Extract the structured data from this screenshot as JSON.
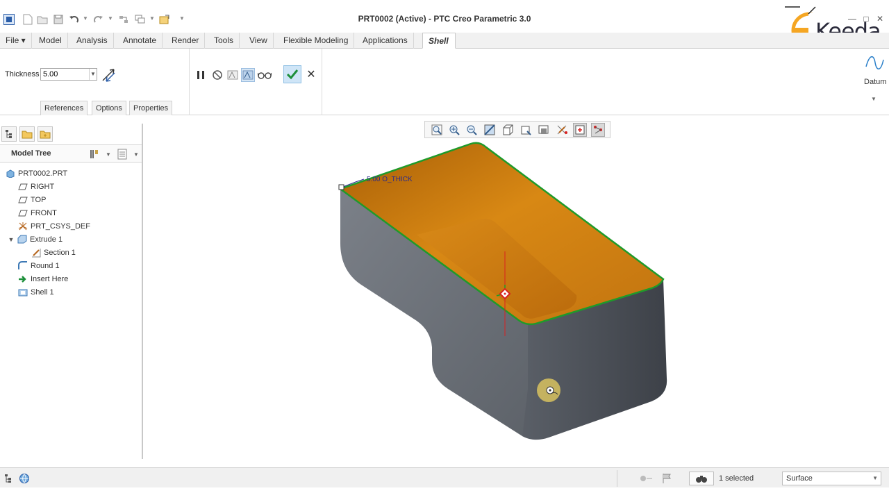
{
  "window": {
    "title": "PRT0002 (Active) - PTC Creo Parametric 3.0",
    "controls": [
      "?",
      "—",
      "□",
      "✕"
    ]
  },
  "quick_access": {
    "icons": [
      "new-file-icon",
      "open-file-icon",
      "save-icon",
      "undo-icon",
      "redo-icon",
      "regenerate-icon",
      "windows-icon",
      "close-window-icon",
      "customize-icon"
    ]
  },
  "ribbon": {
    "tabs": [
      {
        "label": "File ▾"
      },
      {
        "label": "Model"
      },
      {
        "label": "Analysis"
      },
      {
        "label": "Annotate"
      },
      {
        "label": "Render"
      },
      {
        "label": "Tools"
      },
      {
        "label": "View"
      },
      {
        "label": "Flexible Modeling"
      },
      {
        "label": "Applications"
      },
      {
        "label": "Shell"
      }
    ],
    "active_tab": "Shell",
    "thickness": {
      "label": "Thickness",
      "value": "5.00"
    },
    "subtabs": [
      "References",
      "Options",
      "Properties"
    ],
    "datum": {
      "label": "Datum"
    }
  },
  "logo": {
    "text": "Keeda",
    "letter": "E"
  },
  "model_tree": {
    "title": "Model Tree",
    "items": [
      {
        "label": "PRT0002.PRT",
        "icon": "part-icon"
      },
      {
        "label": "RIGHT",
        "icon": "datum-plane-icon"
      },
      {
        "label": "TOP",
        "icon": "datum-plane-icon"
      },
      {
        "label": "FRONT",
        "icon": "datum-plane-icon"
      },
      {
        "label": "PRT_CSYS_DEF",
        "icon": "csys-icon"
      },
      {
        "label": "Extrude 1",
        "icon": "extrude-icon"
      },
      {
        "label": "Section 1",
        "icon": "sketch-icon"
      },
      {
        "label": "Round 1",
        "icon": "round-icon"
      },
      {
        "label": "Insert Here",
        "icon": "insert-arrow-icon"
      },
      {
        "label": "Shell 1",
        "icon": "shell-icon"
      }
    ]
  },
  "graphics": {
    "dimension_label": "5.00 O_THICK",
    "colors": {
      "shell_inside": "#c9770b",
      "shell_outside": "#5a5f66",
      "edge_highlight": "#1f9a2a",
      "axis": "#d92020"
    }
  },
  "status_bar": {
    "selected_text": "1 selected",
    "filter_value": "Surface"
  }
}
